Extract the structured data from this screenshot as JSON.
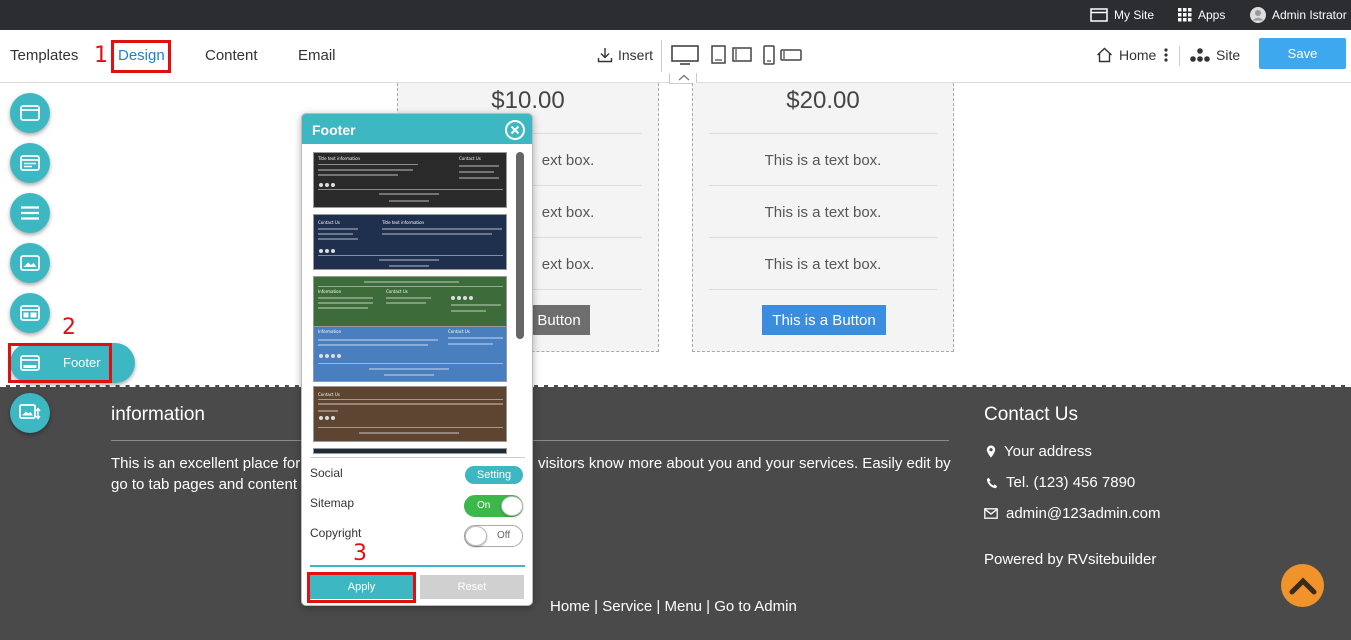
{
  "topbar": {
    "my_site": "My Site",
    "apps": "Apps",
    "user": "Admin Istrator"
  },
  "menu": {
    "templates": "Templates",
    "design": "Design",
    "content": "Content",
    "email": "Email",
    "insert": "Insert",
    "home": "Home",
    "site": "Site",
    "save": "Save"
  },
  "annotations": [
    "1",
    "2",
    "3"
  ],
  "pricing": {
    "cards": [
      {
        "price": "$10.00",
        "lines": [
          "ext box.",
          "ext box.",
          "ext box."
        ],
        "button": "Button"
      },
      {
        "price": "$20.00",
        "lines": [
          "This is a text box.",
          "This is a text box.",
          "This is a text box."
        ],
        "button": "This is a Button"
      }
    ]
  },
  "side_panel": {
    "footer_label": "Footer"
  },
  "dialog": {
    "title": "Footer",
    "templates": [
      {
        "bg": "#2a2a2a",
        "head_left": "Title text information",
        "head_right": "Contact Us"
      },
      {
        "bg": "#1f2f4e",
        "head_left": "Contact Us",
        "head_right": "Title text information"
      },
      {
        "bg": "#3d6b3a",
        "head_left": "Information",
        "head_right": "Contact Us"
      },
      {
        "bg": "#4a7fbf",
        "head_left": "Information",
        "head_right": "Contact Us"
      },
      {
        "bg": "#5e4532",
        "head_left": "Contact Us",
        "head_right": ""
      }
    ],
    "options": {
      "social": "Social",
      "social_button": "Setting",
      "sitemap": "Sitemap",
      "sitemap_state": "On",
      "copyright": "Copyright",
      "copyright_state": "Off"
    },
    "apply": "Apply",
    "reset": "Reset"
  },
  "footer": {
    "heading": "information",
    "body_left": "This is an excellent place for y",
    "body_right": "visitors know more about you and your services. Easily edit by",
    "body_line2": "go to tab pages and content a",
    "contact_heading": "Contact Us",
    "address": "Your address",
    "phone": "Tel. (123) 456 7890",
    "email": "admin@123admin.com",
    "powered": "Powered by RVsitebuilder",
    "links": "Home | Service | Menu | Go to Admin"
  },
  "colors": {
    "accent": "#3db7c2",
    "save": "#3ea8ef",
    "button_blue": "#3b8de0",
    "button_grey": "#6e6e6e",
    "footer_bg": "#4a4a4a",
    "annotation_red": "#e01010",
    "back_to_top": "#f0932b"
  }
}
